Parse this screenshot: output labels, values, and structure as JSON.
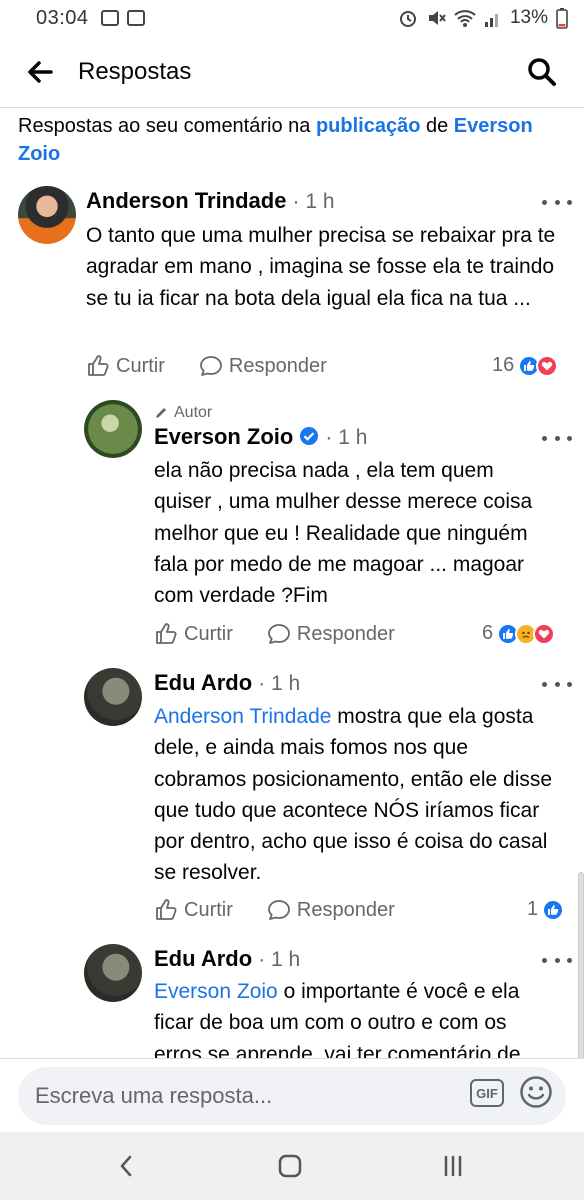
{
  "status_bar": {
    "time": "03:04",
    "battery": "13%"
  },
  "header": {
    "title": "Respostas"
  },
  "context": {
    "prefix": "Respostas ao seu comentário na ",
    "link1": "publicação",
    "mid": " de ",
    "link2": "Everson Zoio"
  },
  "comments": [
    {
      "author": "Anderson Trindade",
      "time": "1 h",
      "text": "O tanto que uma mulher precisa se rebaixar pra te agradar em mano , imagina se fosse ela te traindo se tu ia ficar na bota dela igual ela fica na tua ...",
      "like_label": "Curtir",
      "reply_label": "Responder",
      "reaction_count": "16"
    },
    {
      "tag": "Autor",
      "author": "Everson Zoio",
      "time": "1 h",
      "text": "ela não precisa nada , ela tem quem quiser , uma mulher desse merece coisa melhor que eu ! Realidade que ninguém fala por medo de me magoar ... magoar com verdade ?Fim",
      "like_label": "Curtir",
      "reply_label": "Responder",
      "reaction_count": "6"
    },
    {
      "author": "Edu Ardo",
      "time": "1 h",
      "mention": "Anderson Trindade",
      "text": " mostra que ela gosta dele, e ainda mais fomos nos que cobramos posicionamento, então ele disse que tudo que acontece NÓS iríamos ficar por dentro, acho que isso é coisa do casal se resolver.",
      "like_label": "Curtir",
      "reply_label": "Responder",
      "reaction_count": "1"
    },
    {
      "author": "Edu Ardo",
      "time": "1 h",
      "mention": "Everson Zoio",
      "text": " o importante é você e ela ficar de boa um com o outro e com os erros se aprende, vai ter comentário de"
    }
  ],
  "composer": {
    "placeholder": "Escreva uma resposta...",
    "gif_label": "GIF"
  },
  "colors": {
    "link": "#1b74e4",
    "like": "#1877f2",
    "love": "#f33e58",
    "sad": "#f7b125"
  }
}
